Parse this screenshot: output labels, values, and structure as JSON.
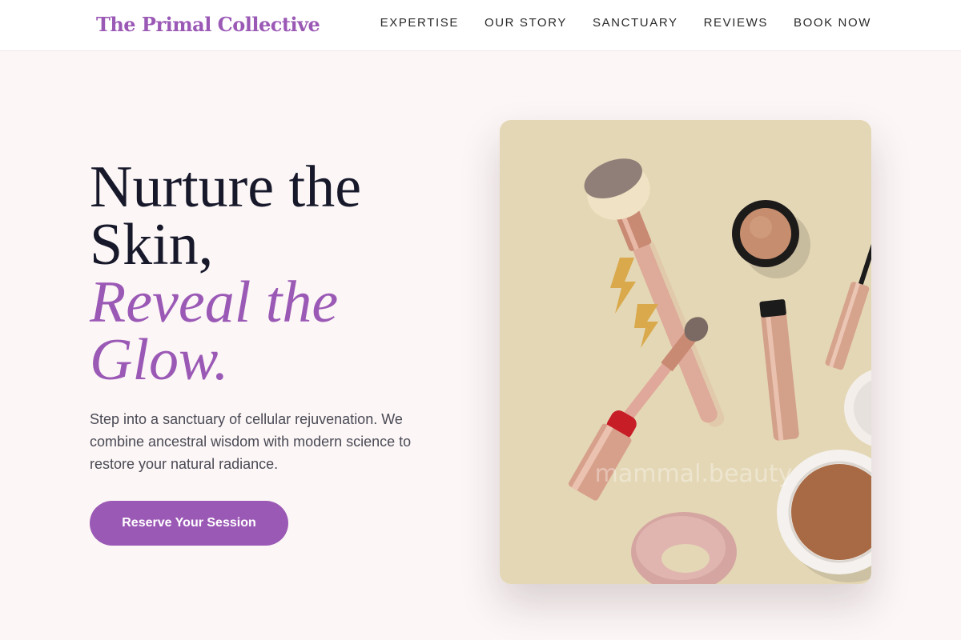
{
  "brand": {
    "name": "The Primal Collective"
  },
  "nav": {
    "items": [
      {
        "label": "EXPERTISE"
      },
      {
        "label": "OUR STORY"
      },
      {
        "label": "SANCTUARY"
      },
      {
        "label": "REVIEWS"
      },
      {
        "label": "BOOK NOW"
      }
    ]
  },
  "hero": {
    "title_line1": "Nurture the",
    "title_line2": "Skin,",
    "accent_line1": "Reveal the",
    "accent_line2": "Glow.",
    "description": "Step into a sanctuary of cellular rejuvenation. We combine ancestral wisdom with modern science to restore your natural radiance.",
    "cta_label": "Reserve Your Session",
    "image": {
      "watermark": "mammal.beauty"
    }
  },
  "colors": {
    "brand_purple": "#9b59b6",
    "heading_dark": "#17192b",
    "page_background": "#fcf6f6",
    "card_background": "#e4d7b5"
  }
}
